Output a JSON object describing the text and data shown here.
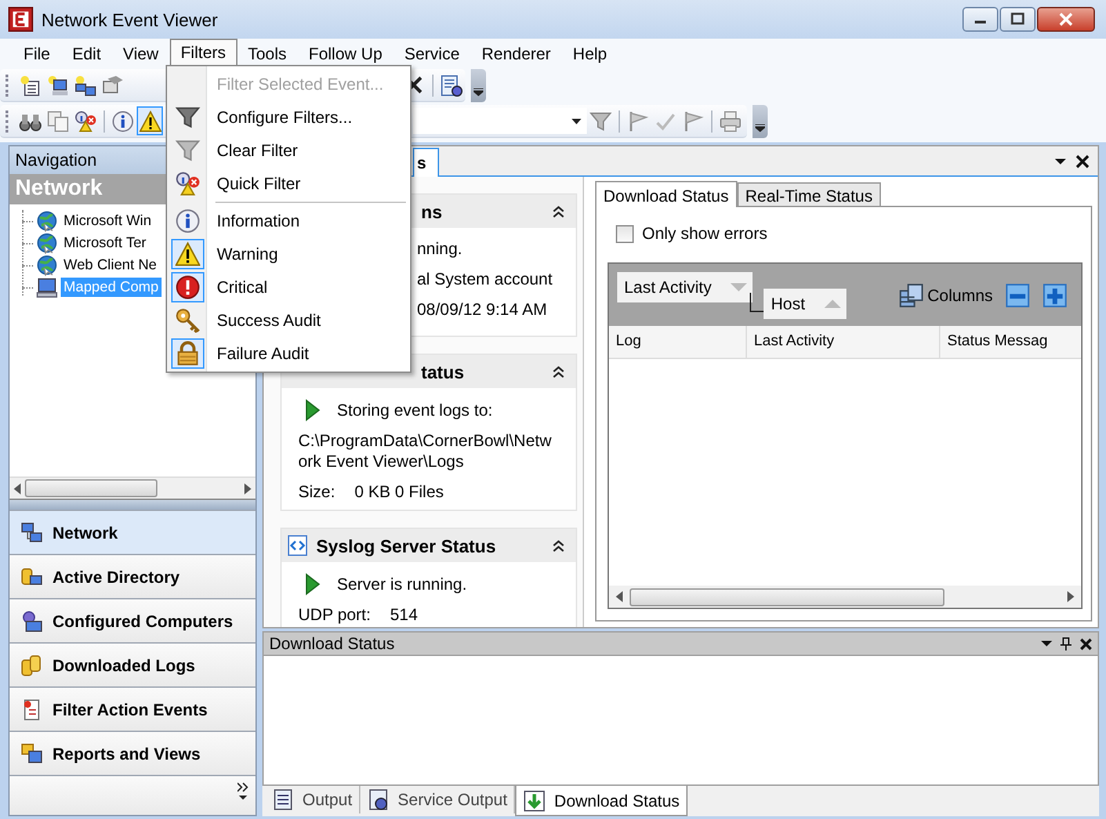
{
  "window": {
    "title": "Network Event Viewer"
  },
  "menu_bar": [
    {
      "label": "File",
      "selected": false
    },
    {
      "label": "Edit",
      "selected": false
    },
    {
      "label": "View",
      "selected": false
    },
    {
      "label": "Filters",
      "selected": true
    },
    {
      "label": "Tools",
      "selected": false
    },
    {
      "label": "Follow Up",
      "selected": false
    },
    {
      "label": "Service",
      "selected": false
    },
    {
      "label": "Renderer",
      "selected": false
    },
    {
      "label": "Help",
      "selected": false
    }
  ],
  "filter_toolbar": [
    {
      "kind": "info",
      "checked": false
    },
    {
      "kind": "warning",
      "checked": true
    }
  ],
  "filters_menu": {
    "groups": [
      [
        {
          "label": "Filter Selected Event...",
          "disabled": true
        },
        {
          "kind": "funnel",
          "label": "Configure Filters...",
          "disabled": false
        },
        {
          "kind": "funnel-light",
          "label": "Clear Filter",
          "disabled": false
        },
        {
          "kind": "quick",
          "label": "Quick Filter",
          "disabled": false
        }
      ],
      [
        {
          "kind": "info",
          "label": "Information",
          "checked": false
        },
        {
          "kind": "warning",
          "label": "Warning",
          "checked": true
        },
        {
          "kind": "critical",
          "label": "Critical",
          "checked": true
        },
        {
          "kind": "key",
          "label": "Success Audit",
          "checked": false
        },
        {
          "kind": "lock",
          "label": "Failure Audit",
          "checked": true
        }
      ]
    ]
  },
  "navigation": {
    "title": "Navigation",
    "section": "Network",
    "tree": [
      {
        "kind": "globe",
        "label": "Microsoft Win",
        "selected": false
      },
      {
        "kind": "globe",
        "label": "Microsoft Ter",
        "selected": false
      },
      {
        "kind": "globe",
        "label": "Web Client Ne",
        "selected": false
      },
      {
        "kind": "computer",
        "label": "Mapped Comp",
        "selected": true
      }
    ],
    "buttons": [
      {
        "kind": "network",
        "label": "Network",
        "selected": true
      },
      {
        "kind": "directory",
        "label": "Active Directory",
        "selected": false
      },
      {
        "kind": "configured",
        "label": "Configured Computers",
        "selected": false
      },
      {
        "kind": "logs",
        "label": "Downloaded Logs",
        "selected": false
      },
      {
        "kind": "filter-events",
        "label": "Filter Action Events",
        "selected": false
      },
      {
        "kind": "reports",
        "label": "Reports and Views",
        "selected": false
      }
    ]
  },
  "document_tab": {
    "label": "s",
    "selected": true
  },
  "status_panels": [
    {
      "kind": "covered",
      "title": "ns",
      "lines": [
        {
          "kind": "covered",
          "text": "nning."
        },
        {
          "kind": "covered",
          "text": "al System account"
        },
        {
          "kind": "covered",
          "text": "08/09/12 9:14 AM"
        }
      ]
    },
    {
      "kind": "covered",
      "title": "tatus",
      "lines": [
        {
          "kind": "status",
          "text": "Storing event logs to:"
        },
        {
          "kind": "path",
          "text": "C:\\ProgramData\\CornerBowl\\Network Event Viewer\\Logs"
        },
        {
          "kind": "field",
          "label": "Size:",
          "text": "0 KB 0 Files"
        }
      ]
    },
    {
      "kind": "syslog",
      "title": "Syslog Server Status",
      "lines": [
        {
          "kind": "status",
          "text": "Server is running."
        },
        {
          "kind": "field",
          "label": "UDP port:",
          "text": "514"
        }
      ]
    }
  ],
  "status_tabs": [
    {
      "label": "Download Status",
      "selected": true
    },
    {
      "label": "Real-Time Status",
      "selected": false
    }
  ],
  "only_errors": {
    "label": "Only show errors",
    "checked": false
  },
  "grid": {
    "group_by": [
      {
        "label": "Last Activity",
        "ascending": false
      },
      {
        "label": "Host",
        "ascending": true
      }
    ],
    "columns_button": "Columns",
    "columns": [
      "Log",
      "Last Activity",
      "Status Messag"
    ]
  },
  "bottom_pane": {
    "title": "Download Status",
    "tabs": [
      {
        "kind": "output",
        "label": "Output",
        "selected": false
      },
      {
        "kind": "service",
        "label": "Service Output",
        "selected": false
      },
      {
        "kind": "download",
        "label": "Download Status",
        "selected": true
      }
    ]
  }
}
